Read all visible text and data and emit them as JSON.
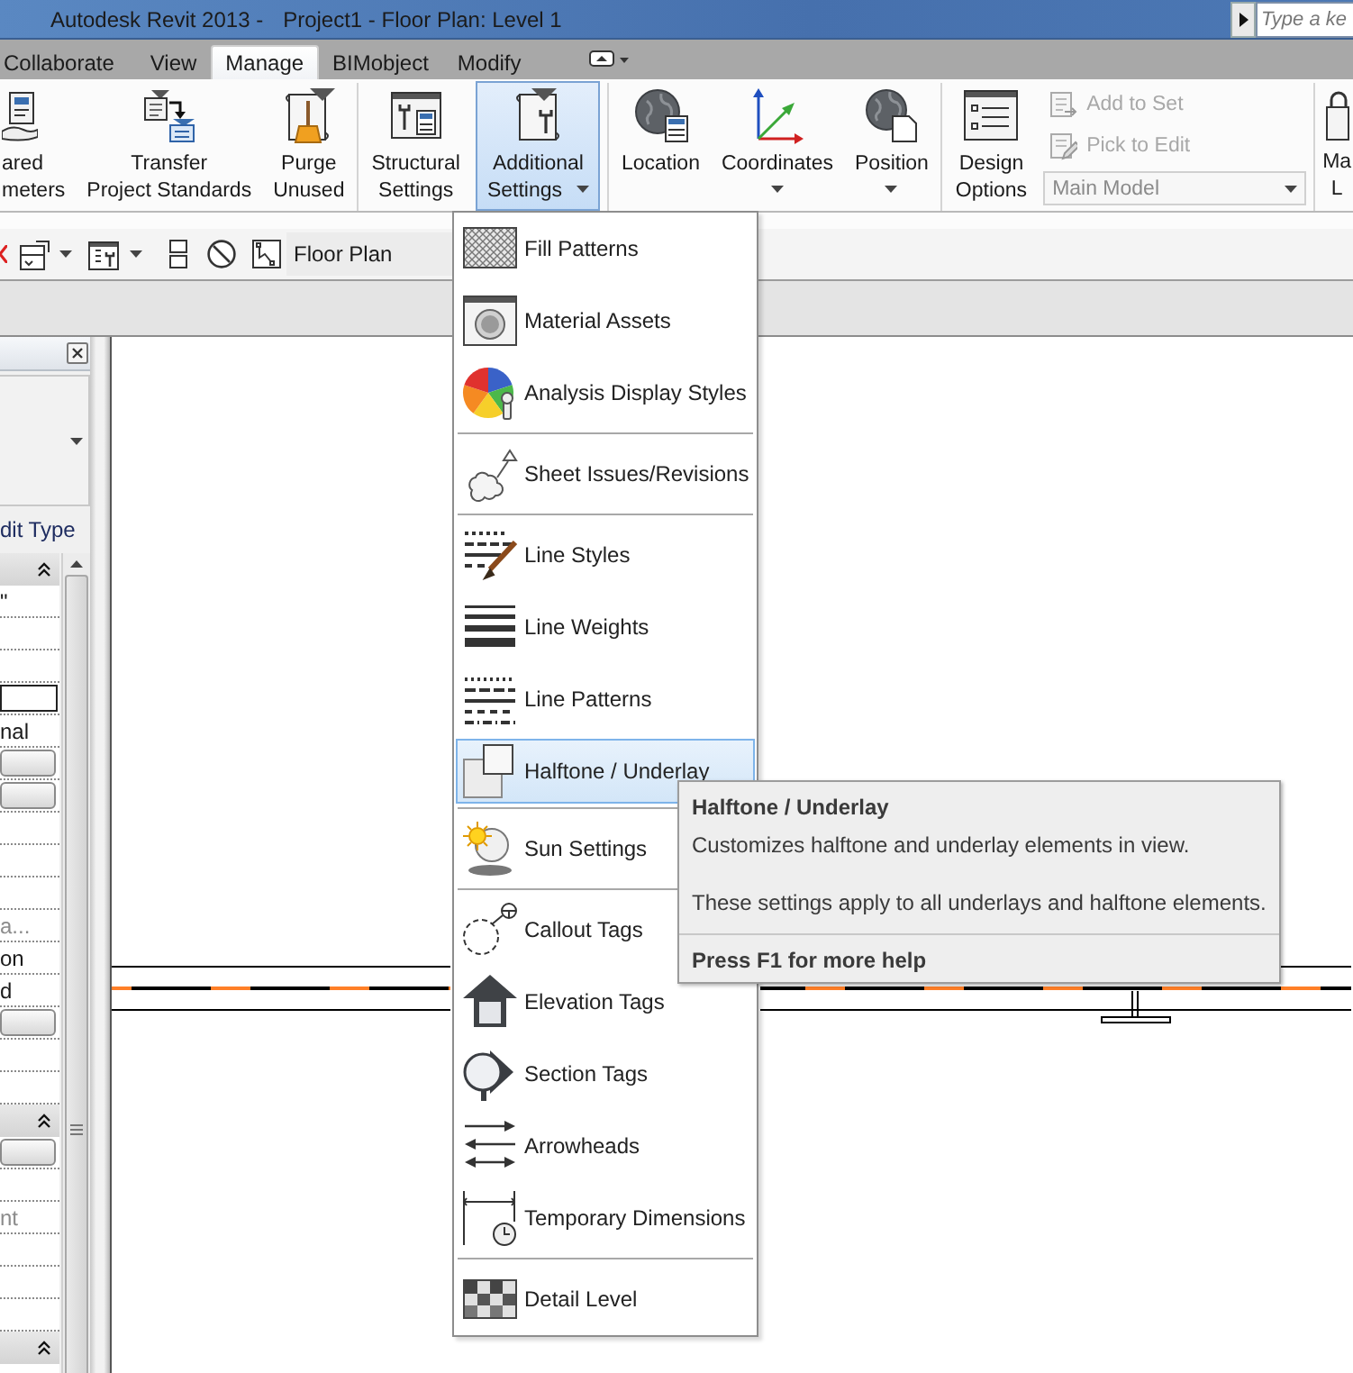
{
  "window": {
    "app_title": "Autodesk Revit 2013 -",
    "document_title": "Project1 - Floor Plan: Level 1",
    "search": {
      "placeholder": "Type a ke"
    }
  },
  "tabs": [
    {
      "label": "Collaborate",
      "selected": false
    },
    {
      "label": "View",
      "selected": false
    },
    {
      "label": "Manage",
      "selected": true
    },
    {
      "label": "BIMobject",
      "selected": false
    },
    {
      "label": "Modify",
      "selected": false
    }
  ],
  "ribbon": {
    "panels": [
      {
        "buttons": [
          {
            "kind": "large",
            "lines": [
              "ared",
              "meters"
            ],
            "selected": false,
            "dropdown": false
          },
          {
            "kind": "large",
            "lines": [
              "Transfer",
              "Project Standards"
            ],
            "selected": false,
            "dropdown": false
          },
          {
            "kind": "large",
            "lines": [
              "Purge",
              "Unused"
            ],
            "selected": false,
            "dropdown": false
          }
        ]
      },
      {
        "buttons": [
          {
            "kind": "large",
            "lines": [
              "Structural",
              "Settings"
            ],
            "selected": false,
            "dropdown": false
          },
          {
            "kind": "large",
            "lines": [
              "Additional",
              "Settings"
            ],
            "selected": true,
            "dropdown": true
          }
        ]
      },
      {
        "buttons": [
          {
            "kind": "large",
            "lines": [
              "Location"
            ],
            "selected": false,
            "dropdown": false
          },
          {
            "kind": "large",
            "lines": [
              "Coordinates"
            ],
            "selected": false,
            "dropdown": true
          },
          {
            "kind": "large",
            "lines": [
              "Position"
            ],
            "selected": false,
            "dropdown": true
          }
        ]
      },
      {
        "buttons": [
          {
            "kind": "large",
            "lines": [
              "Design",
              "Options"
            ],
            "selected": false,
            "dropdown": false
          },
          {
            "kind": "small",
            "label": "Add to Set",
            "disabled": true
          },
          {
            "kind": "small",
            "label": "Pick to Edit",
            "disabled": true
          },
          {
            "kind": "select",
            "value": "Main Model",
            "disabled": true
          }
        ]
      },
      {
        "buttons": [
          {
            "kind": "large",
            "lines": [
              "Ma",
              "L"
            ],
            "selected": false,
            "dropdown": false
          }
        ]
      }
    ]
  },
  "view_toolbar": {
    "view_name": "Floor Plan"
  },
  "properties": {
    "edit_type": "dit Type",
    "rows": [
      {
        "kind": "header",
        "expanded": true
      },
      {
        "kind": "text",
        "text": "\"",
        "disabled": false
      },
      {
        "kind": "empty"
      },
      {
        "kind": "empty"
      },
      {
        "kind": "input"
      },
      {
        "kind": "text",
        "text": "nal",
        "disabled": false
      },
      {
        "kind": "button"
      },
      {
        "kind": "button"
      },
      {
        "kind": "empty"
      },
      {
        "kind": "empty"
      },
      {
        "kind": "empty"
      },
      {
        "kind": "text",
        "text": "a...",
        "disabled": true
      },
      {
        "kind": "text",
        "text": "on",
        "disabled": false
      },
      {
        "kind": "text",
        "text": "d",
        "disabled": false
      },
      {
        "kind": "button"
      },
      {
        "kind": "empty"
      },
      {
        "kind": "empty"
      },
      {
        "kind": "header",
        "expanded": true
      },
      {
        "kind": "button"
      },
      {
        "kind": "empty"
      },
      {
        "kind": "text",
        "text": "nt",
        "disabled": true
      },
      {
        "kind": "empty"
      },
      {
        "kind": "empty"
      },
      {
        "kind": "empty"
      },
      {
        "kind": "header",
        "expanded": true
      }
    ]
  },
  "menu": {
    "groups": [
      {
        "items": [
          {
            "label": "Fill Patterns",
            "selected": false
          },
          {
            "label": "Material Assets",
            "selected": false
          },
          {
            "label": "Analysis Display Styles",
            "selected": false
          }
        ]
      },
      {
        "items": [
          {
            "label": "Sheet Issues/Revisions",
            "selected": false
          }
        ]
      },
      {
        "items": [
          {
            "label": "Line Styles",
            "selected": false
          },
          {
            "label": "Line Weights",
            "selected": false
          },
          {
            "label": "Line Patterns",
            "selected": false
          },
          {
            "label": "Halftone / Underlay",
            "selected": true
          }
        ]
      },
      {
        "items": [
          {
            "label": "Sun Settings",
            "selected": false
          }
        ]
      },
      {
        "items": [
          {
            "label": "Callout Tags",
            "selected": false
          },
          {
            "label": "Elevation Tags",
            "selected": false
          },
          {
            "label": "Section Tags",
            "selected": false
          },
          {
            "label": "Arrowheads",
            "selected": false
          },
          {
            "label": "Temporary Dimensions",
            "selected": false
          }
        ]
      },
      {
        "items": [
          {
            "label": "Detail Level",
            "selected": false
          }
        ]
      }
    ]
  },
  "tooltip": {
    "title": "Halftone / Underlay",
    "description": "Customizes halftone and underlay elements in view.",
    "note": "These settings apply to all underlays and halftone elements.",
    "help": "Press F1 for more help"
  }
}
